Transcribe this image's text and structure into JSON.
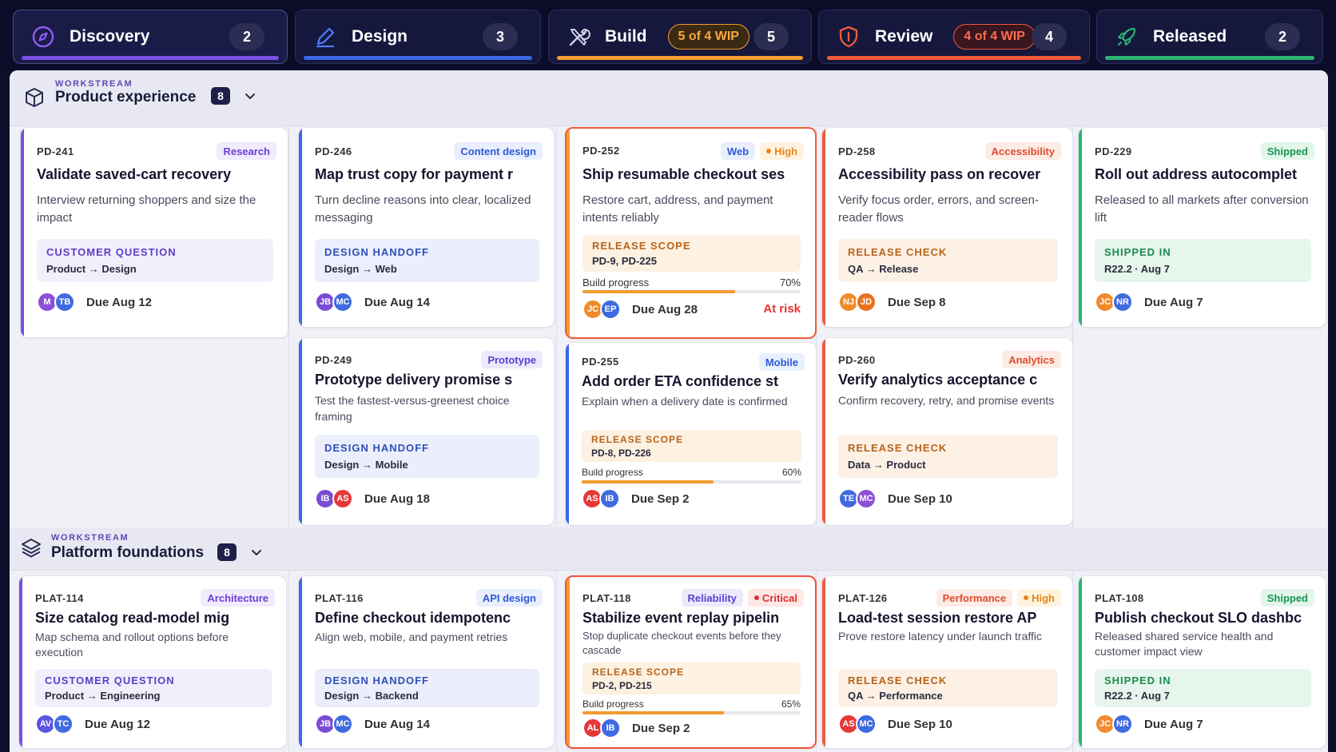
{
  "colors": {
    "purple": "#7b4ee6",
    "blue": "#3b66e8",
    "orange": "#f59b2f",
    "red": "#ef5a3c",
    "green": "#2bb673"
  },
  "stages": [
    {
      "name": "Discovery",
      "count": "2",
      "icon": "compass-icon",
      "wip": ""
    },
    {
      "name": "Design",
      "count": "3",
      "icon": "pen-icon",
      "wip": ""
    },
    {
      "name": "Build",
      "count": "5",
      "icon": "tools-icon",
      "wip": "5 of 4 WIP"
    },
    {
      "name": "Review",
      "count": "4",
      "icon": "shield-icon",
      "wip": "4 of 4 WIP"
    },
    {
      "name": "Released",
      "count": "2",
      "icon": "rocket-icon",
      "wip": ""
    }
  ],
  "workstreams": [
    {
      "eyebrow": "WORKSTREAM",
      "title": "Product experience",
      "count": "8",
      "icon": "box-icon"
    },
    {
      "eyebrow": "WORKSTREAM",
      "title": "Platform foundations",
      "count": "8",
      "icon": "layers-icon"
    }
  ],
  "progress_label": "Build progress",
  "cards": {
    "pd241": {
      "id": "PD-241",
      "tags": [
        "Research"
      ],
      "title": "Validate saved-cart recovery",
      "desc": "Interview returning shoppers and size the impact",
      "handoff_label": "CUSTOMER QUESTION",
      "handoff_value": "Product → Design",
      "avatars": [
        "M",
        "TB"
      ],
      "due": "Due Aug 12"
    },
    "pd246": {
      "id": "PD-246",
      "tags": [
        "Content design"
      ],
      "title": "Map trust copy for payment r",
      "desc": "Turn decline reasons into clear, localized messaging",
      "handoff_label": "DESIGN HANDOFF",
      "handoff_value": "Design → Web",
      "avatars": [
        "JB",
        "MC"
      ],
      "due": "Due Aug 14"
    },
    "pd249": {
      "id": "PD-249",
      "tags": [
        "Prototype"
      ],
      "title": "Prototype delivery promise s",
      "desc": "Test the fastest-versus-greenest choice framing",
      "handoff_label": "DESIGN HANDOFF",
      "handoff_value": "Design → Mobile",
      "avatars": [
        "IB",
        "AS"
      ],
      "due": "Due Aug 18"
    },
    "pd252": {
      "id": "PD-252",
      "tags": [
        "Web",
        "High"
      ],
      "title": "Ship resumable checkout ses",
      "desc": "Restore cart, address, and payment intents reliably",
      "handoff_label": "RELEASE SCOPE",
      "handoff_value": "PD-9, PD-225",
      "progress": "70%",
      "progress_value": 0.7,
      "avatars": [
        "JC",
        "EP"
      ],
      "due": "Due Aug 28",
      "risk": "At risk"
    },
    "pd255": {
      "id": "PD-255",
      "tags": [
        "Mobile"
      ],
      "title": "Add order ETA confidence st",
      "desc": "Explain when a delivery date is confirmed",
      "handoff_label": "RELEASE SCOPE",
      "handoff_value": "PD-8, PD-226",
      "progress": "60%",
      "progress_value": 0.6,
      "avatars": [
        "AS",
        "IB"
      ],
      "due": "Due Sep 2"
    },
    "pd258": {
      "id": "PD-258",
      "tags": [
        "Accessibility"
      ],
      "title": "Accessibility pass on recover",
      "desc": "Verify focus order, errors, and screen-reader flows",
      "handoff_label": "RELEASE CHECK",
      "handoff_value": "QA → Release",
      "avatars": [
        "NJ",
        "JD"
      ],
      "due": "Due Sep 8"
    },
    "pd260": {
      "id": "PD-260",
      "tags": [
        "Analytics"
      ],
      "title": "Verify analytics acceptance c",
      "desc": "Confirm recovery, retry, and promise events",
      "handoff_label": "RELEASE CHECK",
      "handoff_value": "Data → Product",
      "avatars": [
        "TE",
        "MC"
      ],
      "due": "Due Sep 10"
    },
    "pd229": {
      "id": "PD-229",
      "tags": [
        "Shipped"
      ],
      "title": "Roll out address autocomplet",
      "desc": "Released to all markets after conversion lift",
      "handoff_label": "SHIPPED IN",
      "handoff_value": "R22.2 · Aug 7",
      "avatars": [
        "JC",
        "NR"
      ],
      "due": "Due Aug 7"
    },
    "plat114": {
      "id": "PLAT-114",
      "tags": [
        "Architecture"
      ],
      "title": "Size catalog read-model mig",
      "desc": "Map schema and rollout options before execution",
      "handoff_label": "CUSTOMER QUESTION",
      "handoff_value": "Product → Engineering",
      "avatars": [
        "AV",
        "TC"
      ],
      "due": "Due Aug 12"
    },
    "plat116": {
      "id": "PLAT-116",
      "tags": [
        "API design"
      ],
      "title": "Define checkout idempotenc",
      "desc": "Align web, mobile, and payment retries",
      "handoff_label": "DESIGN HANDOFF",
      "handoff_value": "Design → Backend",
      "avatars": [
        "JB",
        "MC"
      ],
      "due": "Due Aug 14"
    },
    "plat118": {
      "id": "PLAT-118",
      "tags": [
        "Reliability",
        "Critical"
      ],
      "title": "Stabilize event replay pipelin",
      "desc": "Stop duplicate checkout events before they cascade",
      "handoff_label": "RELEASE SCOPE",
      "handoff_value": "PD-2, PD-215",
      "progress": "65%",
      "progress_value": 0.65,
      "avatars": [
        "AL",
        "IB"
      ],
      "due": "Due Sep 2"
    },
    "plat126": {
      "id": "PLAT-126",
      "tags": [
        "Performance",
        "High"
      ],
      "title": "Load-test session restore AP",
      "desc": "Prove restore latency under launch traffic",
      "handoff_label": "RELEASE CHECK",
      "handoff_value": "QA → Performance",
      "avatars": [
        "AS",
        "MC"
      ],
      "due": "Due Sep 10"
    },
    "plat108": {
      "id": "PLAT-108",
      "tags": [
        "Shipped"
      ],
      "title": "Publish checkout SLO dashbc",
      "desc": "Released shared service health and customer impact view",
      "handoff_label": "SHIPPED IN",
      "handoff_value": "R22.2 · Aug 7",
      "avatars": [
        "JC",
        "NR"
      ],
      "due": "Due Aug 7"
    }
  }
}
